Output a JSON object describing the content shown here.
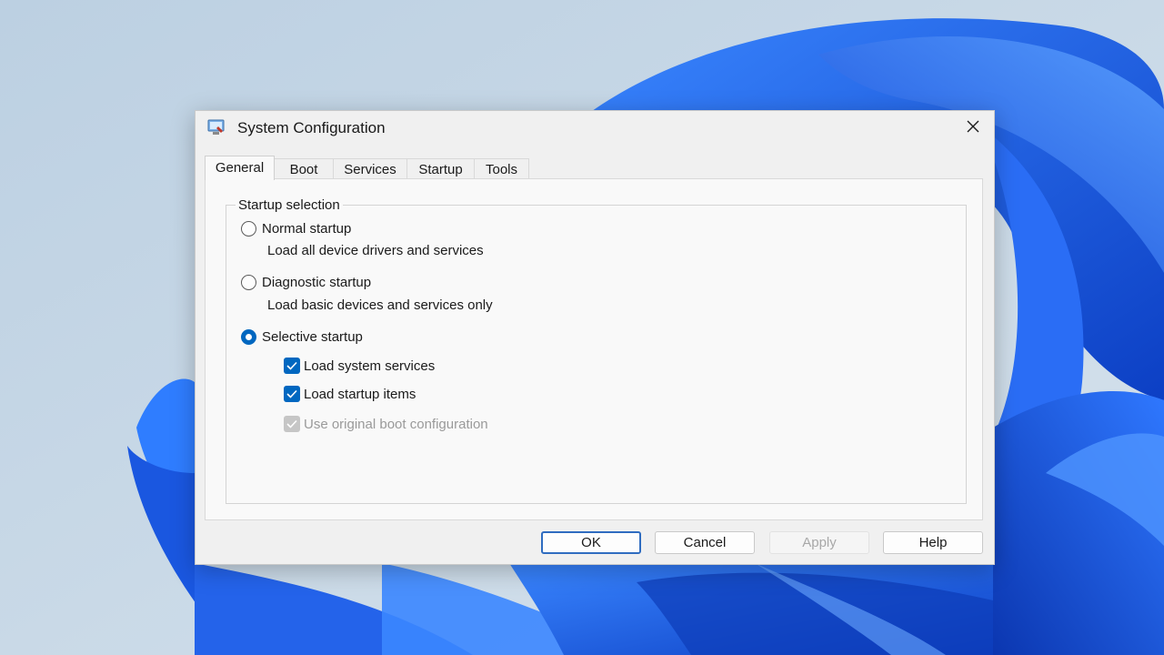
{
  "window": {
    "title": "System Configuration",
    "close_glyph": "✕",
    "icon": "system-config-icon"
  },
  "tabs": [
    {
      "label": "General",
      "active": true
    },
    {
      "label": "Boot",
      "active": false
    },
    {
      "label": "Services",
      "active": false
    },
    {
      "label": "Startup",
      "active": false
    },
    {
      "label": "Tools",
      "active": false
    }
  ],
  "general": {
    "group_label": "Startup selection",
    "options": [
      {
        "label": "Normal startup",
        "description": "Load all device drivers and services",
        "selected": false
      },
      {
        "label": "Diagnostic startup",
        "description": "Load basic devices and services only",
        "selected": false
      },
      {
        "label": "Selective startup",
        "description": "",
        "selected": true
      }
    ],
    "selective_items": [
      {
        "label": "Load system services",
        "checked": true,
        "enabled": true
      },
      {
        "label": "Load startup items",
        "checked": true,
        "enabled": true
      },
      {
        "label": "Use original boot configuration",
        "checked": true,
        "enabled": false
      }
    ]
  },
  "buttons": {
    "ok": "OK",
    "cancel": "Cancel",
    "apply": "Apply",
    "help": "Help"
  },
  "colors": {
    "accent": "#0067c0",
    "dialog_bg": "#f0f0f0",
    "wallpaper_blue": "#1d5fe8"
  }
}
